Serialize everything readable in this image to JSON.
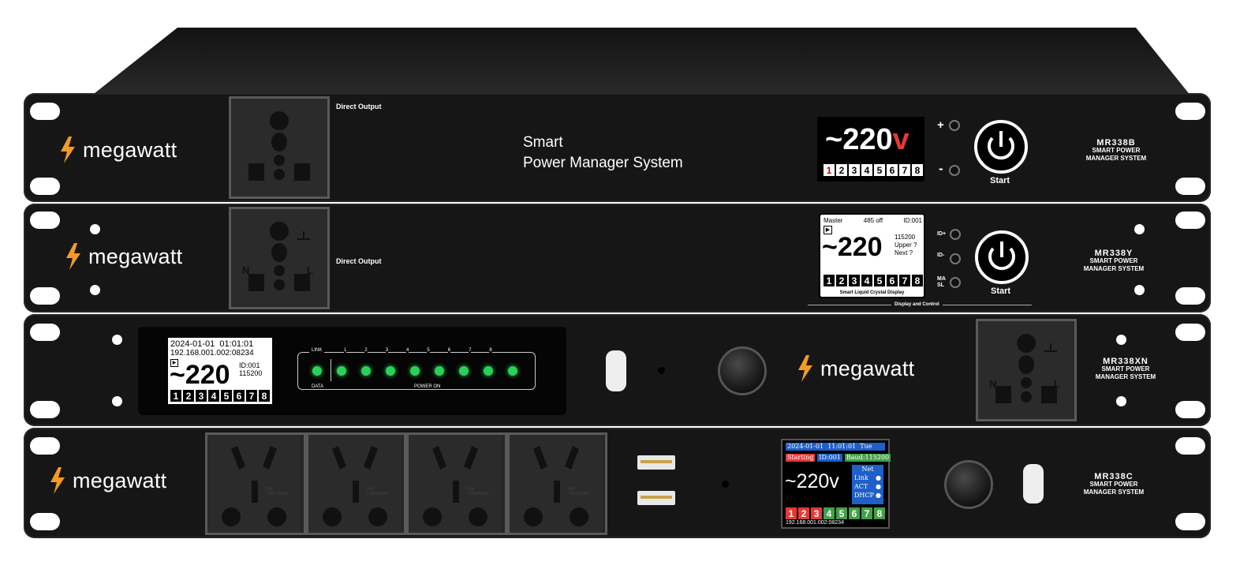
{
  "brand": {
    "name": "megawatt",
    "accent": "#f39a25"
  },
  "units": [
    {
      "model": "MR338B",
      "model_desc_1": "SMART POWER",
      "model_desc_2": "MANAGER SYSTEM",
      "socket_label": "Direct Output",
      "title_line1": "Smart",
      "title_line2": "Power Manager System",
      "display": {
        "voltage": "~220",
        "unit": "v",
        "channels": [
          "1",
          "2",
          "3",
          "4",
          "5",
          "6",
          "7",
          "8"
        ]
      },
      "plus_label": "+",
      "minus_label": "-",
      "start_label": "Start"
    },
    {
      "model": "MR338Y",
      "model_desc_1": "SMART POWER",
      "model_desc_2": "MANAGER SYSTEM",
      "socket_label": "Direct Output",
      "socket_n": "N",
      "socket_l": "L",
      "lcd": {
        "mode": "Master",
        "bus": "485",
        "bus_state": "off",
        "id": "ID:001",
        "voltage": "~220",
        "baud": "115200",
        "upper": "Upper ?",
        "next": "Next ?",
        "channels": [
          "1",
          "2",
          "3",
          "4",
          "5",
          "6",
          "7",
          "8"
        ],
        "caption": "Smart Liquid Crystal Display"
      },
      "id_plus_label": "ID+",
      "id_minus_label": "ID-",
      "ma_sl_label_1": "MA",
      "ma_sl_label_2": "SL",
      "start_label": "Start",
      "section_label": "Display and Control"
    },
    {
      "model": "MR338XN",
      "model_desc_1": "SMART POWER",
      "model_desc_2": "MANAGER SYSTEM",
      "socket_n": "N",
      "socket_l": "L",
      "lcd": {
        "date": "2024-01-01",
        "time": "01:01:01",
        "ip": "192.168.001.002:08234",
        "voltage": "~220",
        "id": "ID:001",
        "baud": "115200",
        "channels": [
          "1",
          "2",
          "3",
          "4",
          "5",
          "6",
          "7",
          "8"
        ]
      },
      "leds": {
        "link_label": "LINK",
        "data_label": "DATA",
        "power_on_label": "POWER ON",
        "numbers": [
          "1",
          "2",
          "3",
          "4",
          "5",
          "6",
          "7",
          "8"
        ]
      }
    },
    {
      "model": "MR338C",
      "model_desc_1": "SMART POWER",
      "model_desc_2": "MANAGER SYSTEM",
      "outlet_rating": "10A ~220V/50Hz",
      "tft": {
        "date": "2024-01-01",
        "time": "11:01:01",
        "day": "Tue",
        "status": "Starting",
        "id": "ID:001",
        "baud": "Baud:115200",
        "voltage": "~220v",
        "net_title": "Net",
        "net_items": [
          "Link",
          "ACT",
          "DHCP"
        ],
        "channels": [
          "1",
          "2",
          "3",
          "4",
          "5",
          "6",
          "7",
          "8"
        ],
        "channel_colors": [
          "#e53935",
          "#e53935",
          "#e53935",
          "#43a047",
          "#43a047",
          "#43a047",
          "#43a047",
          "#43a047"
        ],
        "ip": "192.168.001.002:08234"
      }
    }
  ]
}
